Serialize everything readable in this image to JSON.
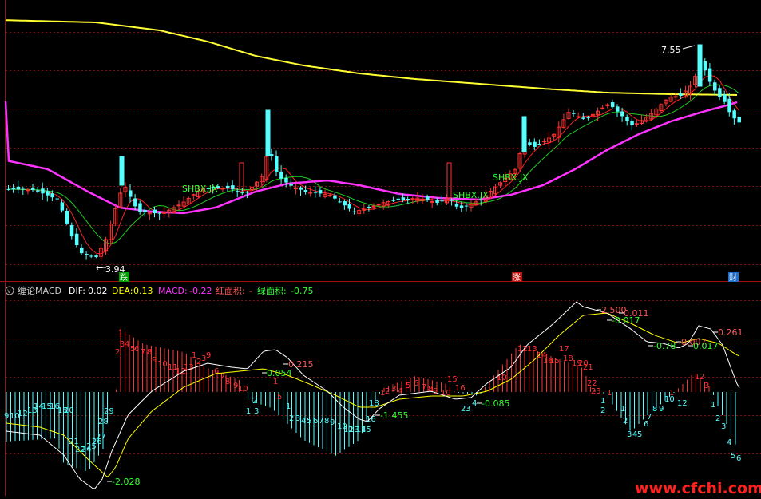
{
  "chart_data": [
    {
      "type": "candlestick",
      "panel": "price",
      "title": "",
      "y_annotations": [
        {
          "label": "7.55",
          "value": 7.55
        },
        {
          "label": "3.94",
          "value": 3.94
        }
      ],
      "markers": [
        {
          "label": "跌",
          "color": "#00a000"
        },
        {
          "label": "涨",
          "color": "#c01010"
        },
        {
          "label": "财",
          "color": "#1f6fd0"
        }
      ],
      "signals": [
        {
          "label": "SHBX.JX"
        },
        {
          "label": "SHBX.JX"
        },
        {
          "label": "SHBX.JX"
        }
      ],
      "ma_colors": {
        "long": "#ffff33",
        "mid_pink": "#ff33ff",
        "short_red": "#ff2222",
        "short_green": "#22cc22"
      },
      "colors": {
        "up": "#ff3232",
        "down": "#54ffff"
      }
    },
    {
      "type": "bar",
      "panel": "indicator",
      "title": "缠论MACD",
      "header": {
        "name": "缠论MACD",
        "dif_label": "DIF:",
        "dif_value": "0.02",
        "dea_label": "DEA:",
        "dea_value": "0.13",
        "macd_label": "MACD:",
        "macd_value": "-0.22",
        "red_area_label": "红面积:",
        "red_area_value": "-",
        "green_area_label": "绿面积:",
        "green_area_value": "-0.75"
      },
      "annotations": [
        {
          "label": "-2.028",
          "value": -2.028
        },
        {
          "label": "0.215",
          "value": 0.215
        },
        {
          "label": "0.054",
          "value": 0.054
        },
        {
          "label": "-1.455",
          "value": -1.455
        },
        {
          "label": "-0.085",
          "value": -0.085
        },
        {
          "label": "2.500",
          "value": 2.5
        },
        {
          "label": "0.011",
          "value": 0.011
        },
        {
          "label": "-0.017",
          "value": -0.017
        },
        {
          "label": "0.007",
          "value": 0.007
        },
        {
          "label": "-0.78",
          "value": -0.78
        },
        {
          "label": "0.017",
          "value": 0.017
        },
        {
          "label": "0.261",
          "value": 0.261
        }
      ],
      "colors": {
        "positive": "#ff3232",
        "negative": "#54ffff",
        "dif": "#ffffff",
        "dea": "#ffff00"
      }
    }
  ],
  "watermark": "www.cfchi.com"
}
